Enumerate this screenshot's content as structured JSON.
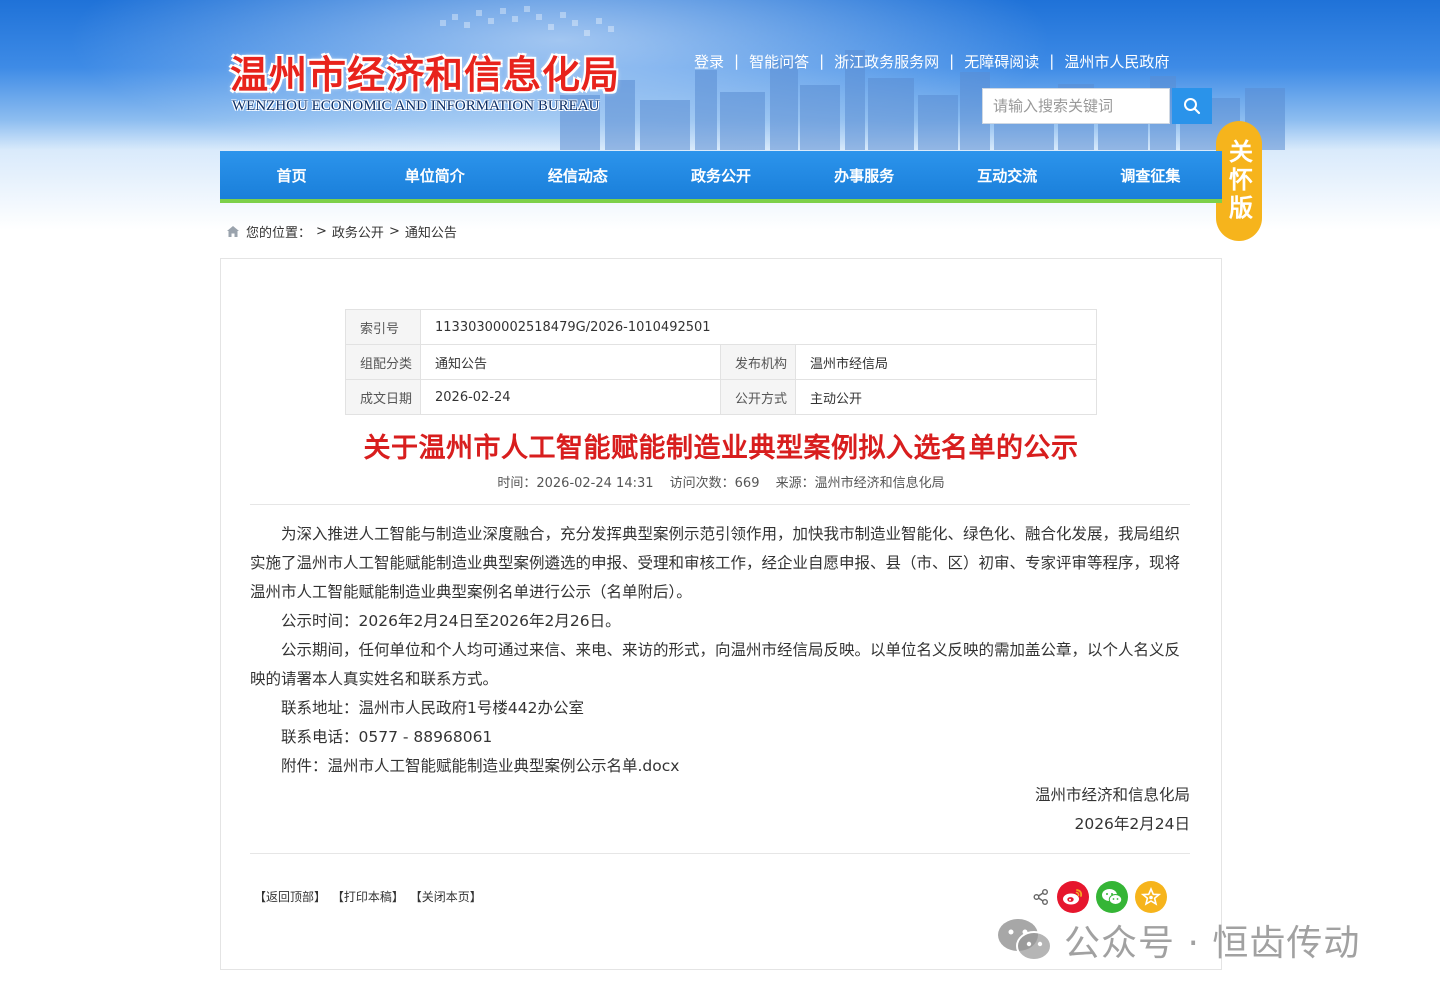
{
  "site": {
    "name_cn": "温州市经济和信息化局",
    "name_en": "WENZHOU ECONOMIC AND INFORMATION BUREAU",
    "top_links": [
      "登录",
      "智能问答",
      "浙江政务服务网",
      "无障碍阅读",
      "温州市人民政府"
    ],
    "search_placeholder": "请输入搜索关键词",
    "care_badge": "关怀版"
  },
  "nav": [
    "首页",
    "单位简介",
    "经信动态",
    "政务公开",
    "办事服务",
    "互动交流",
    "调查征集"
  ],
  "breadcrumb": {
    "label": "您的位置：",
    "items": [
      "政务公开",
      "通知公告"
    ]
  },
  "meta": {
    "index_label": "索引号",
    "index_value": "11330300002518479G/2026-1010492501",
    "category_label": "组配分类",
    "category_value": "通知公告",
    "publisher_label": "发布机构",
    "publisher_value": "温州市经信局",
    "date_label": "成文日期",
    "date_value": "2026-02-24",
    "mode_label": "公开方式",
    "mode_value": "主动公开"
  },
  "article": {
    "title": "关于温州市人工智能赋能制造业典型案例拟入选名单的公示",
    "time": "时间：2026-02-24 14:31",
    "visits": "访问次数：669",
    "source": "来源：温州市经济和信息化局",
    "paragraphs": [
      "为深入推进人工智能与制造业深度融合，充分发挥典型案例示范引领作用，加快我市制造业智能化、绿色化、融合化发展，我局组织实施了温州市人工智能赋能制造业典型案例遴选的申报、受理和审核工作，经企业自愿申报、县（市、区）初审、专家评审等程序，现将温州市人工智能赋能制造业典型案例名单进行公示（名单附后）。",
      "公示时间：2026年2月24日至2026年2月26日。",
      "公示期间，任何单位和个人均可通过来信、来电、来访的形式，向温州市经信局反映。以单位名义反映的需加盖公章，以个人名义反映的请署本人真实姓名和联系方式。",
      "联系地址：温州市人民政府1号楼442办公室",
      "联系电话：0577 - 88968061",
      "附件：温州市人工智能赋能制造业典型案例公示名单.docx"
    ],
    "signature": "温州市经济和信息化局",
    "sign_date": "2026年2月24日"
  },
  "footer": {
    "back_top": "【返回顶部】",
    "print": "【打印本稿】",
    "close": "【关闭本页】"
  },
  "share_icons": [
    "share-icon",
    "weibo-icon",
    "wechat-icon",
    "star-icon"
  ],
  "watermark": {
    "text": "公众号 · 恒齿传动"
  },
  "colors": {
    "brand_red": "#e8231c",
    "nav_blue": "#1a7fda",
    "nav_accent_green": "#7dd04a",
    "title_red": "#d81e1e",
    "care_yellow": "#f6b41c"
  }
}
